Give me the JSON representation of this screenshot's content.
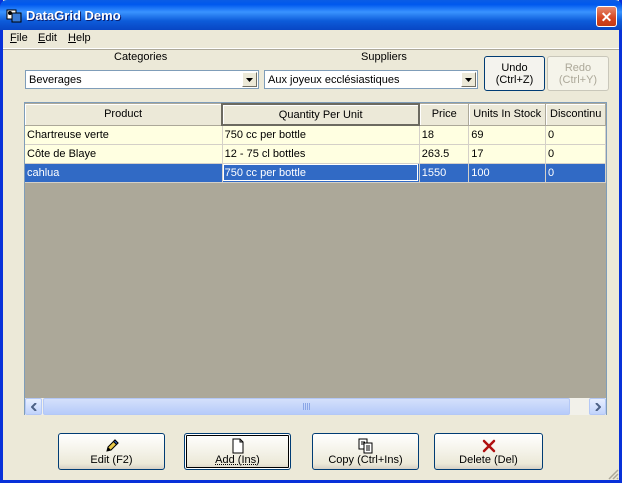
{
  "window": {
    "title": "DataGrid Demo",
    "close": "✕"
  },
  "menu": [
    {
      "label": "File",
      "mnemonic": "F",
      "rest": "ile"
    },
    {
      "label": "Edit",
      "mnemonic": "E",
      "rest": "dit"
    },
    {
      "label": "Help",
      "mnemonic": "H",
      "rest": "elp"
    }
  ],
  "filters": {
    "categories_label": "Categories",
    "categories_value": "Beverages",
    "suppliers_label": "Suppliers",
    "suppliers_value": "Aux joyeux ecclésiastiques"
  },
  "undo": {
    "line1": "Undo",
    "line2": "(Ctrl+Z)"
  },
  "redo": {
    "line1": "Redo",
    "line2": "(Ctrl+Y)"
  },
  "grid": {
    "columns": [
      "Product",
      "Quantity Per Unit",
      "Price",
      "Units In Stock",
      "Discontinu"
    ],
    "rows": [
      [
        "Chartreuse verte",
        "750 cc per bottle",
        "18",
        "69",
        "0"
      ],
      [
        "Côte de Blaye",
        "12 - 75 cl bottles",
        "263.5",
        "17",
        "0"
      ],
      [
        "cahlua",
        "750 cc per bottle",
        "1550",
        "100",
        "0"
      ]
    ],
    "selected_row": 2,
    "current_column": 1
  },
  "actions": {
    "edit": "Edit (F2)",
    "add": "Add (Ins)",
    "copy": "Copy (Ctrl+Ins)",
    "delete": "Delete (Del)"
  },
  "colors": {
    "selection": "#316ac5",
    "row_bg": "#ffffe1",
    "empty_grid": "#aca899"
  }
}
